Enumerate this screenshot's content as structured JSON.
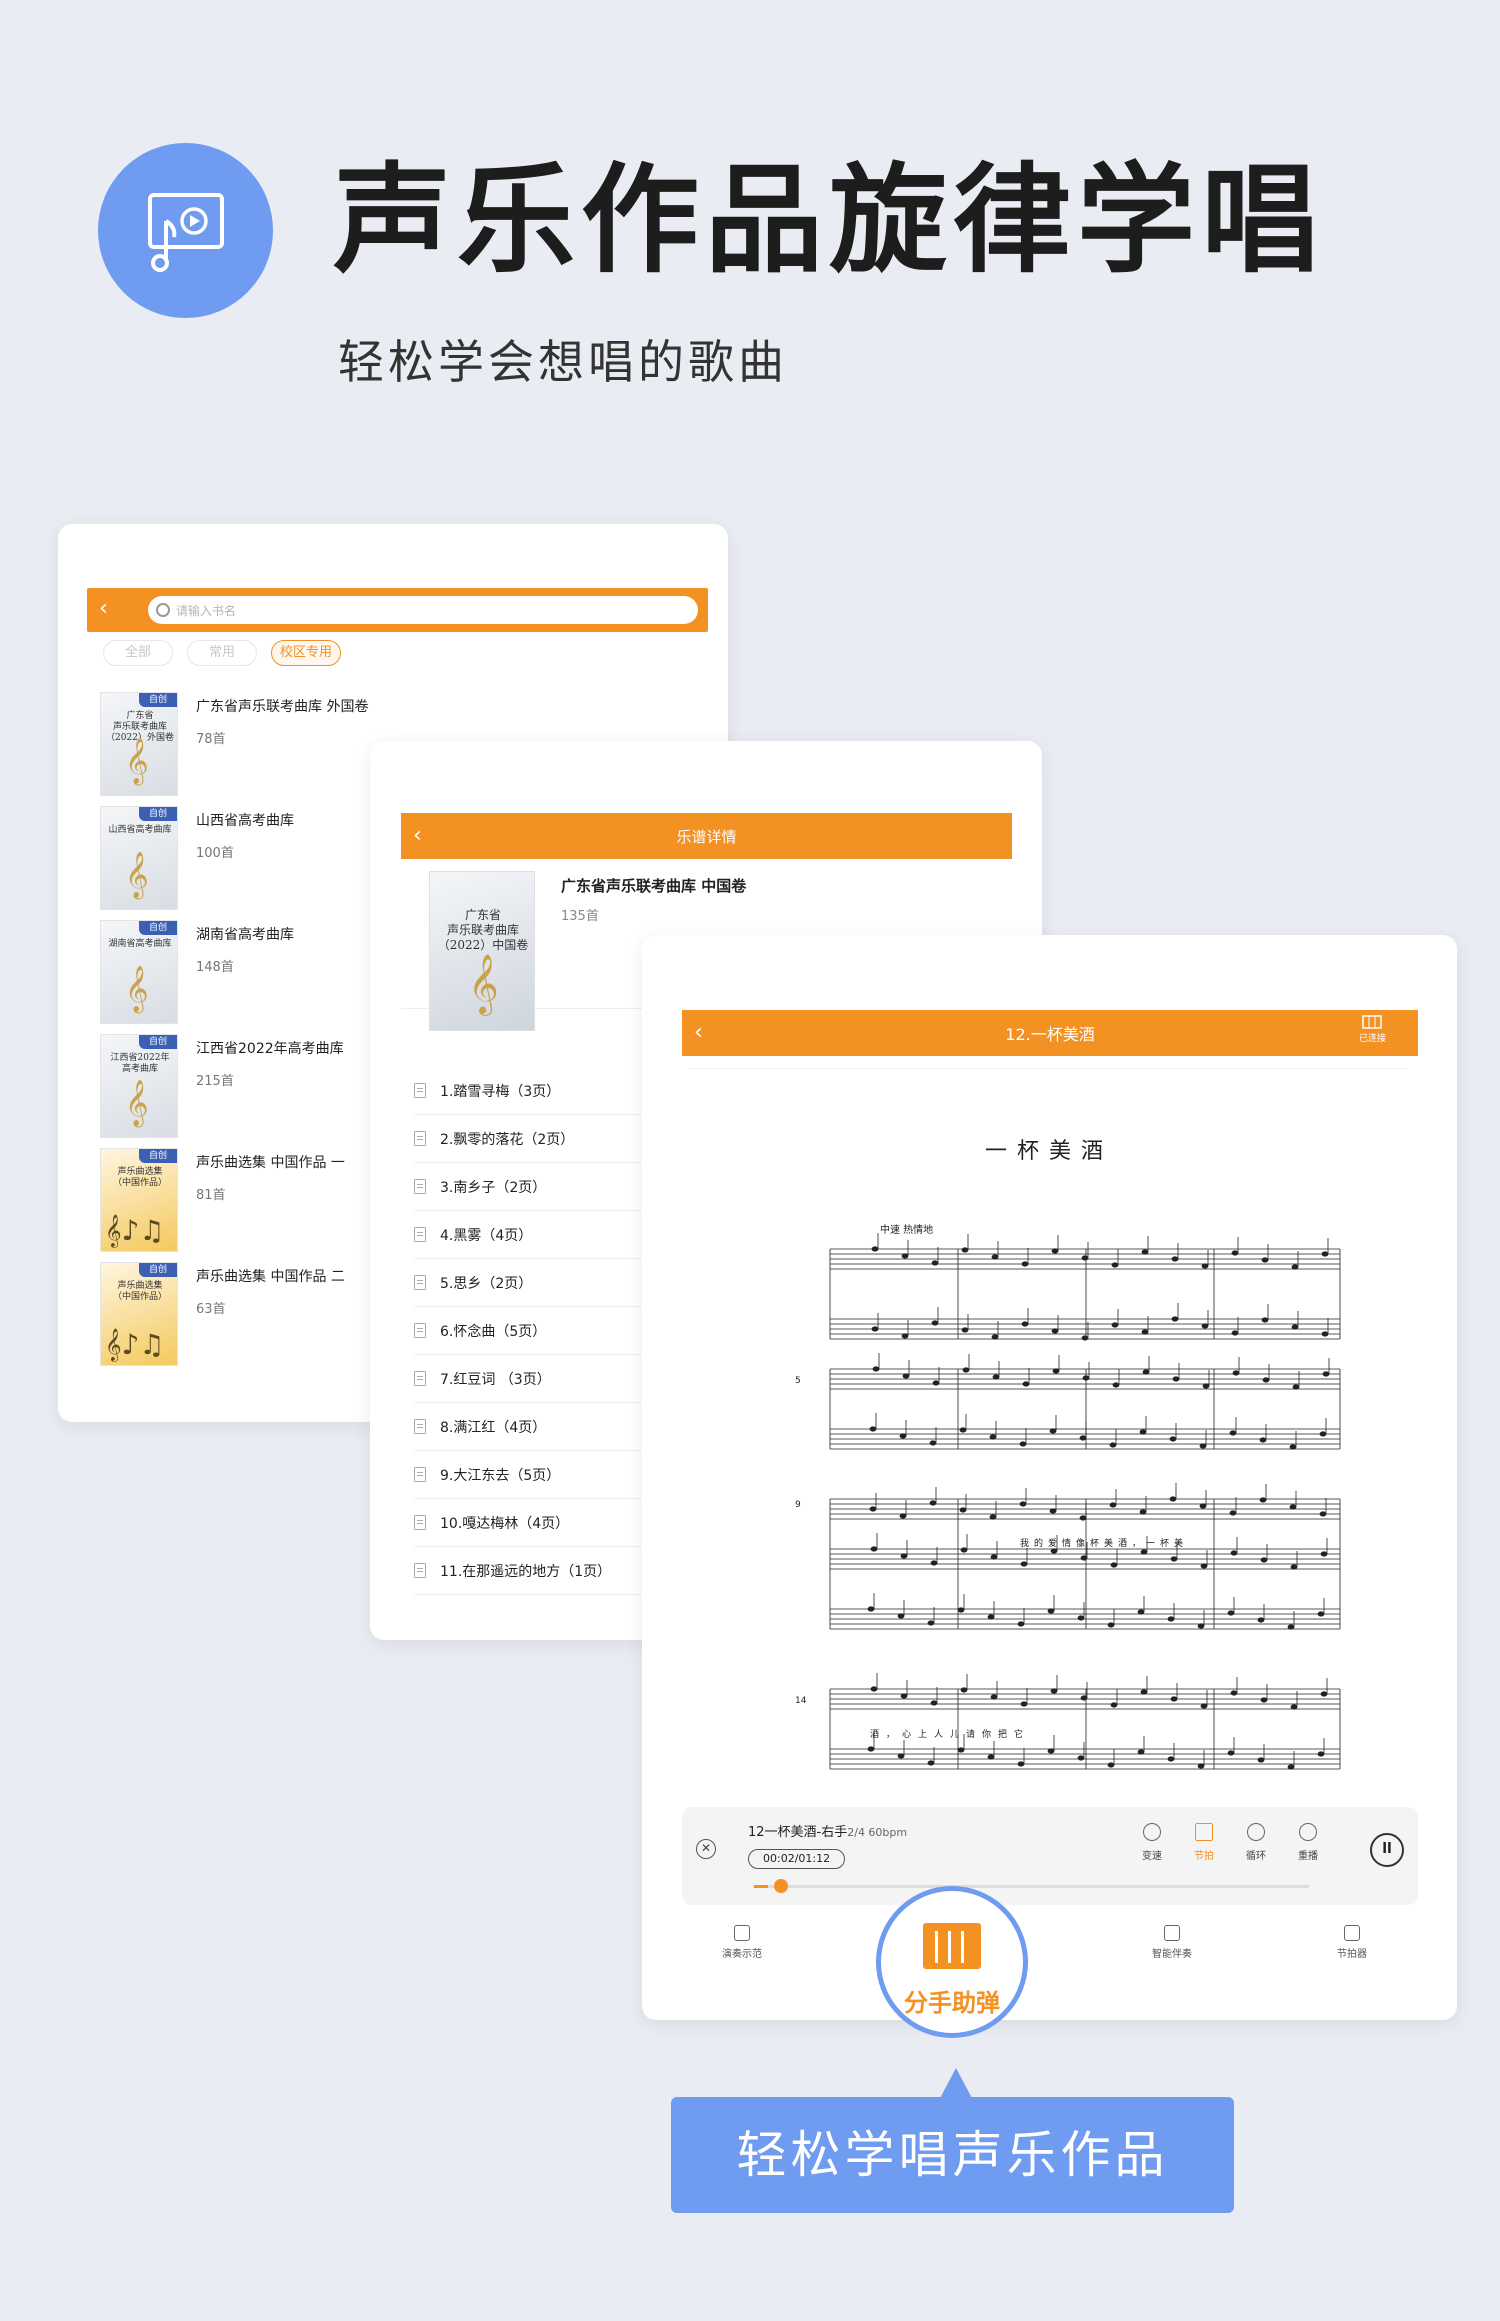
{
  "hero": {
    "title": "声乐作品旋律学唱",
    "subtitle": "轻松学会想唱的歌曲",
    "icon": "music-video-icon"
  },
  "library": {
    "search_placeholder": "请输入书名",
    "tabs": [
      {
        "label": "全部",
        "active": false
      },
      {
        "label": "常用",
        "active": false
      },
      {
        "label": "校区专用",
        "active": true
      }
    ],
    "books": [
      {
        "badge": "自创",
        "cover_text": "广东省\n声乐联考曲库\n（2022）外国卷",
        "title": "广东省声乐联考曲库 外国卷",
        "count": "78首",
        "style": "silver"
      },
      {
        "badge": "自创",
        "cover_text": "山西省高考曲库",
        "title": "山西省高考曲库",
        "count": "100首",
        "style": "silver"
      },
      {
        "badge": "自创",
        "cover_text": "湖南省高考曲库",
        "title": "湖南省高考曲库",
        "count": "148首",
        "style": "silver"
      },
      {
        "badge": "自创",
        "cover_text": "江西省2022年\n高考曲库",
        "title": "江西省2022年高考曲库",
        "count": "215首",
        "style": "silver"
      },
      {
        "badge": "自创",
        "cover_text": "声乐曲选集\n（中国作品）",
        "title": "声乐曲选集 中国作品 一",
        "count": "81首",
        "style": "gold"
      },
      {
        "badge": "自创",
        "cover_text": "声乐曲选集\n（中国作品）",
        "title": "声乐曲选集 中国作品 二",
        "count": "63首",
        "style": "gold"
      }
    ]
  },
  "detail": {
    "header_title": "乐谱详情",
    "cover_text": "广东省\n声乐联考曲库\n（2022）中国卷",
    "book_title": "广东省声乐联考曲库 中国卷",
    "count": "135首",
    "songs": [
      "1.踏雪寻梅（3页）",
      "2.飘零的落花（2页）",
      "3.南乡子（2页）",
      "4.黑雾（4页）",
      "5.思乡（2页）",
      "6.怀念曲（5页）",
      "7.红豆词 （3页）",
      "8.满江红（4页）",
      "9.大江东去（5页）",
      "10.嘎达梅林（4页）",
      "11.在那遥远的地方（1页）"
    ]
  },
  "score": {
    "header_title": "12.一杯美酒",
    "connect_label": "已连接",
    "sheet_title": "一杯美酒",
    "tempo_mark": "中速 热情地",
    "measure_numbers": [
      "5",
      "9",
      "14"
    ],
    "lyrics_line1": "我的爱情像杯美酒，一杯美",
    "lyrics_line2": "酒，心上人儿请你把它",
    "player": {
      "title": "12一杯美酒-右手",
      "meta": "2/4 60bpm",
      "time": "00:02/01:12",
      "progress_fraction": 0.025,
      "controls": [
        {
          "label": "变速",
          "active": false
        },
        {
          "label": "节拍",
          "active": true
        },
        {
          "label": "循环",
          "active": false
        },
        {
          "label": "重播",
          "active": false
        }
      ]
    },
    "bottom_nav": [
      "演奏示范",
      "智能伴奏",
      "节拍器"
    ]
  },
  "highlight": {
    "label": "分手助弹"
  },
  "callout": {
    "text": "轻松学唱声乐作品"
  },
  "colors": {
    "accent": "#f39122",
    "brand_blue": "#6f9bf0",
    "background": "#e9edf3"
  }
}
